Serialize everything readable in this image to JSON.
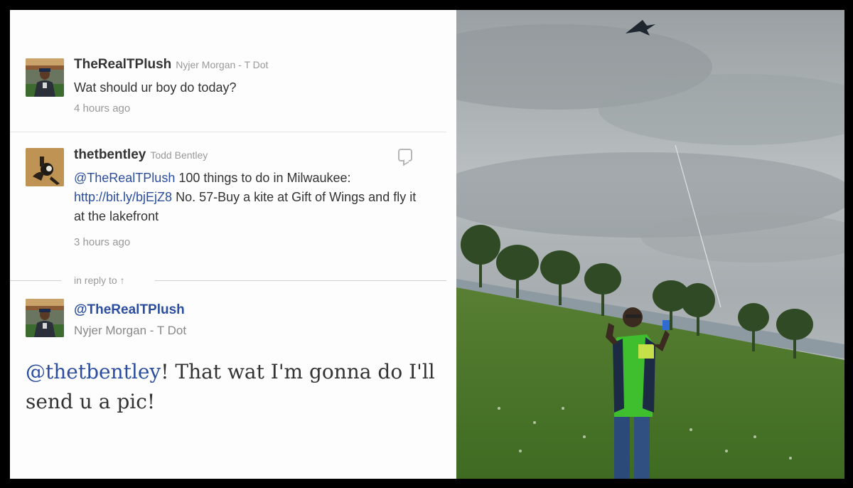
{
  "tweets": [
    {
      "screen_name": "TheRealTPlush",
      "real_name": "Nyjer Morgan - T Dot",
      "text": "Wat should ur boy do today?",
      "time": "4 hours ago"
    },
    {
      "screen_name": "thetbentley",
      "real_name": "Todd Bentley",
      "mention": "@TheRealTPlush",
      "text_after_mention": " 100 things to do in Milwaukee:",
      "link": "http://bit.ly/bjEjZ8",
      "text_after_link": " No. 57-Buy a kite at Gift of Wings and fly it at the lakefront",
      "time": "3 hours ago"
    }
  ],
  "reply_label": "in reply to ↑",
  "focus_tweet": {
    "screen_name": "@TheRealTPlush",
    "real_name": "Nyjer Morgan - T Dot",
    "mention": "@thetbentley",
    "text": "! That wat I'm gonna do I'll send u a pic!"
  },
  "colors": {
    "link": "#2b4ea0",
    "text": "#333333",
    "muted": "#999999",
    "sky": "#aeb3b6",
    "grass": "#4f7a2a",
    "shirt": "#3fbf2d"
  },
  "icons": [
    "reply-icon"
  ]
}
